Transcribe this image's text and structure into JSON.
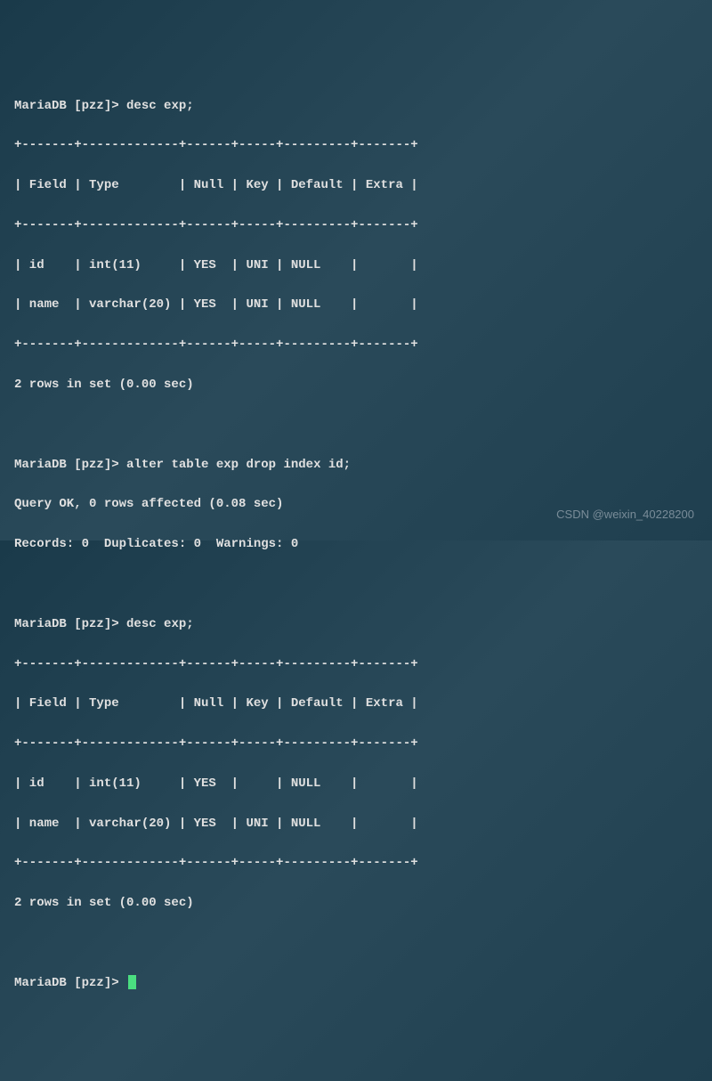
{
  "prompt": "MariaDB [pzz]>",
  "cmd1": "desc exp;",
  "border": "+-------+-------------+------+-----+---------+-------+",
  "header": "| Field | Type        | Null | Key | Default | Extra |",
  "table1": {
    "row1": "| id    | int(11)     | YES  | UNI | NULL    |       |",
    "row2": "| name  | varchar(20) | YES  | UNI | NULL    |       |"
  },
  "result": "2 rows in set (0.00 sec)",
  "cmd2": "alter table exp drop index id;",
  "query_ok": "Query OK, 0 rows affected (0.08 sec)",
  "records": "Records: 0  Duplicates: 0  Warnings: 0",
  "cmd3": "desc exp;",
  "table2": {
    "row1": "| id    | int(11)     | YES  |     | NULL    |       |",
    "row2": "| name  | varchar(20) | YES  | UNI | NULL    |       |"
  },
  "watermark": "CSDN @weixin_40228200"
}
